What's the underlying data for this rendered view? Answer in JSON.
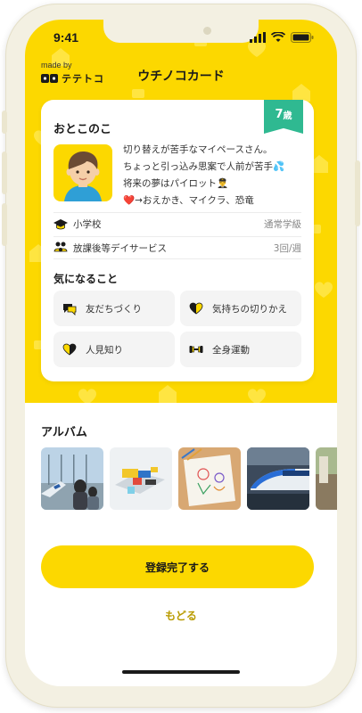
{
  "status_bar": {
    "time": "9:41"
  },
  "header": {
    "made_by": "made by",
    "brand": "テテトコ",
    "title": "ウチノコカード"
  },
  "profile": {
    "name": "おとこのこ",
    "age_number": "7",
    "age_unit": "歳",
    "description": [
      "切り替えが苦手なマイペースさん。",
      "ちょっと引っ込み思案で人前が苦手💦",
      "将来の夢はパイロット👨‍✈️",
      "❤️→おえかき、マイクラ、恐竜"
    ],
    "info_rows": [
      {
        "icon": "graduation-cap-icon",
        "label": "小学校",
        "value": "通常学級"
      },
      {
        "icon": "people-icon",
        "label": "放課後等デイサービス",
        "value": "3回/週"
      }
    ]
  },
  "concerns": {
    "title": "気になること",
    "items": [
      {
        "icon": "speech-bubble-icon",
        "label": "友だちづくり"
      },
      {
        "icon": "heart-icon",
        "label": "気持ちの切りかえ"
      },
      {
        "icon": "heart-icon",
        "label": "人見知り"
      },
      {
        "icon": "dumbbell-icon",
        "label": "全身運動"
      }
    ]
  },
  "album": {
    "title": "アルバム",
    "photos": [
      "airport-photo",
      "lego-photo",
      "drawing-photo",
      "train-photo",
      "partial-photo"
    ]
  },
  "actions": {
    "complete_label": "登録完了する",
    "back_label": "もどる"
  },
  "colors": {
    "brand_yellow": "#fcd800",
    "age_badge_green": "#2fb991",
    "back_link": "#b99b00"
  }
}
